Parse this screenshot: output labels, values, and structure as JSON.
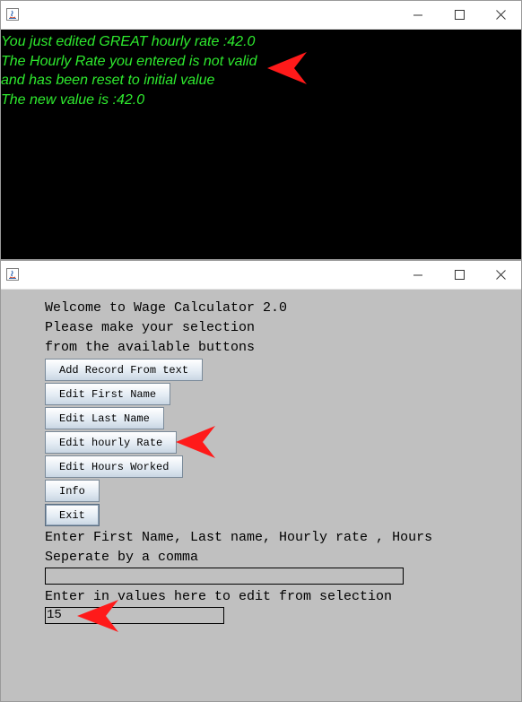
{
  "console_window": {
    "lines": [
      "You just edited GREAT hourly rate :42.0",
      "The Hourly Rate you entered is not valid",
      "and has been reset to initial value",
      "The new value is :42.0"
    ],
    "text_color": "#2eea2e",
    "background": "#000000"
  },
  "calculator_window": {
    "intro": [
      "Welcome to Wage Calculator 2.0",
      "Please make your selection",
      "from the available buttons"
    ],
    "buttons": {
      "add_record": "Add Record From text",
      "edit_first": "Edit First Name",
      "edit_last": "Edit Last Name",
      "edit_rate": "Edit hourly Rate",
      "edit_hours": "Edit Hours Worked",
      "info": "Info",
      "exit": "Exit"
    },
    "record_prompt": [
      "Enter First Name, Last name, Hourly rate , Hours",
      "Seperate by a comma"
    ],
    "record_field_value": "",
    "edit_prompt": "Enter in values here to edit from selection",
    "edit_field_value": "15",
    "background": "#c0c0c0"
  },
  "icons": {
    "app": "java-icon",
    "minimize": "minimize-icon",
    "maximize": "maximize-icon",
    "close": "close-icon",
    "annotation": "red-arrow-icon"
  },
  "annotation_color": "#ff1a1a"
}
